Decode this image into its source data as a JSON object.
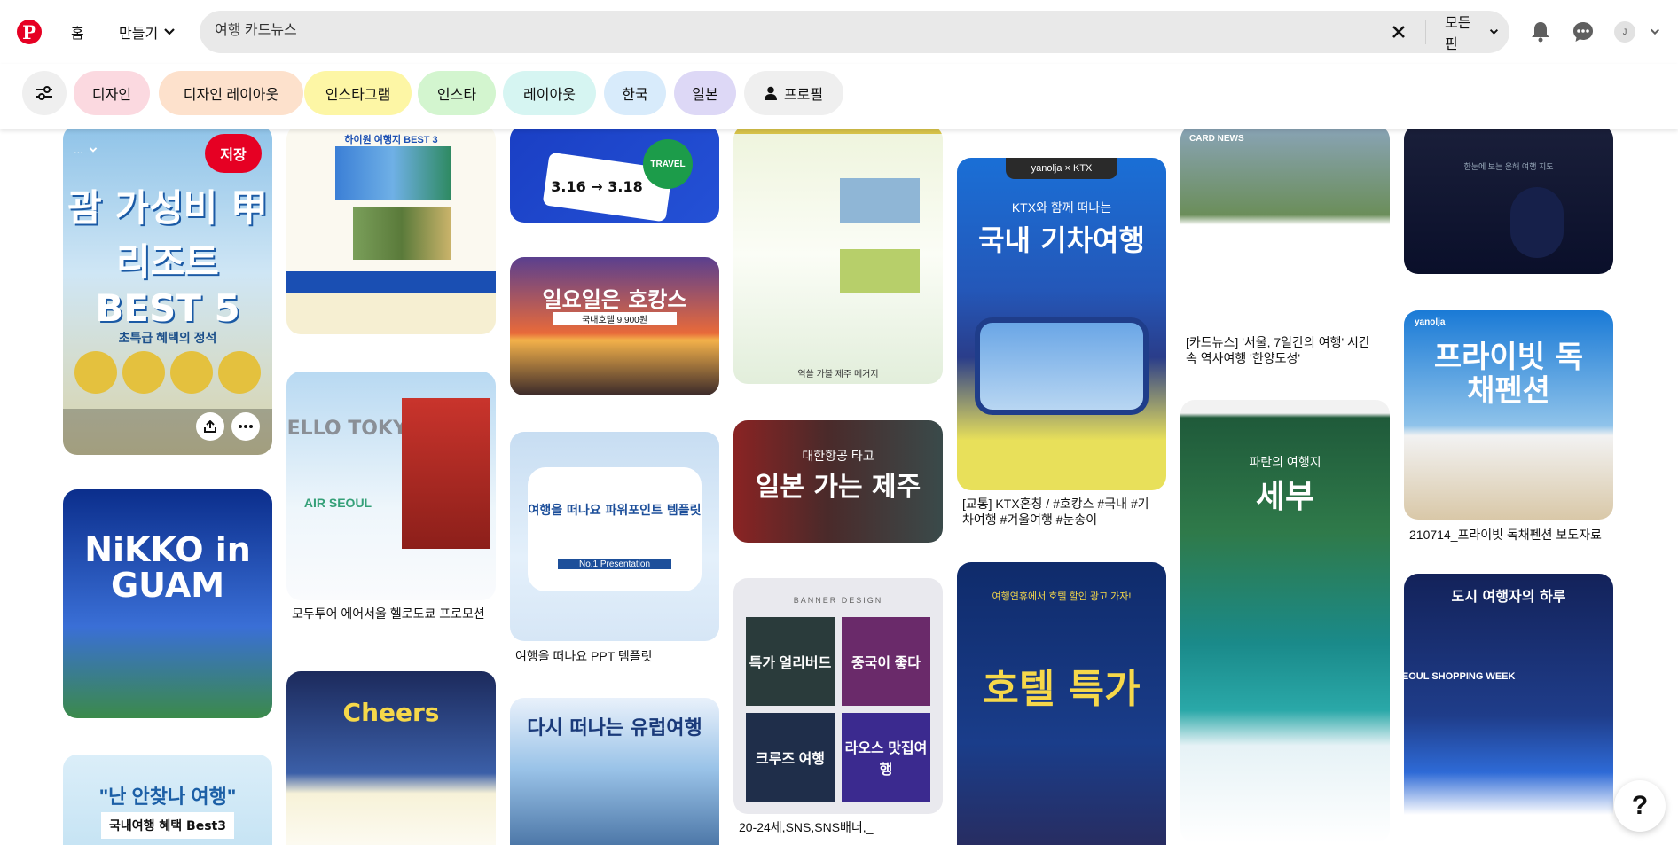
{
  "header": {
    "logo_letter": "P",
    "nav_home": "홈",
    "nav_create": "만들기",
    "search_value": "여행 카드뉴스",
    "filter_dropdown": "모든 핀",
    "avatar_initial": "J"
  },
  "chips": [
    {
      "label": "디자인",
      "color": "#fbd9e0"
    },
    {
      "label": "디자인 레이아웃",
      "color": "#fde1cc"
    },
    {
      "label": "인스타그램",
      "color": "#fdf6a5"
    },
    {
      "label": "인스타",
      "color": "#d3f5cf"
    },
    {
      "label": "레이아웃",
      "color": "#d6f5f2"
    },
    {
      "label": "한국",
      "color": "#d8ebfb"
    },
    {
      "label": "일본",
      "color": "#ddd8f6"
    },
    {
      "label": "프로필",
      "color": "#efefef"
    }
  ],
  "pins": {
    "p1": {
      "text": "괌 가성비 甲 리조트 BEST 5",
      "sub": "초특급 혜택의 정석",
      "dropdown": "...",
      "save": "저장"
    },
    "p2": {
      "text": "NiKKO in GUAM"
    },
    "p3": {
      "text": "국내여행 혜택 Best3",
      "sub": "\"난 안찾나 여행\""
    },
    "p4": {
      "text": "하이원 여행지 BEST 3"
    },
    "p5": {
      "text": "HELLO TOKYO",
      "sub": "AIR SEOUL",
      "title": "모두투어 에어서울 헬로도쿄 프로모션"
    },
    "p6": {
      "text": "Cheers"
    },
    "p7": {
      "text": "3.16 → 3.18",
      "sub": "TRAVEL"
    },
    "p8": {
      "text": "일요일은 호캉스",
      "sub": "국내호텔 9,900원"
    },
    "p9": {
      "text": "여행을 떠나요 파워포인트 템플릿",
      "sub": "No.1 Presentation",
      "title": "여행을 떠나요 PPT 템플릿"
    },
    "p10": {
      "text": "다시 떠나는 유럽여행"
    },
    "p11": {
      "text": "역쓸 가볼 제주 메거지"
    },
    "p12": {
      "text": "일본 가는 제주",
      "sub": "대한항공 타고"
    },
    "p13": {
      "text": "BANNER DESIGN",
      "t1": "특가 얼리버드",
      "t2": "중국이 좋다",
      "t3": "크루즈 여행",
      "t4": "라오스 맛집여행",
      "title": "20-24세,SNS,SNS배너,_"
    },
    "p14": {
      "text": "국내 기차여행",
      "sub": "KTX와 함께 떠나는",
      "brand": "yanolja × KTX",
      "title": "[교통] KTX혼칭 / #호캉스 #국내 #기차여행 #겨울여행 #눈송이"
    },
    "p15": {
      "text": "호텔 특가",
      "sub": "여행연휴에서 호텔 할인 광고 가자!"
    },
    "p16": {
      "text": "CARD NEWS",
      "title": "[카드뉴스] '서울, 7일간의 여행' 시간 속 역사여행 '한양도성'"
    },
    "p17": {
      "text": "세부",
      "sub": "파란의 여행지"
    },
    "p18": {
      "text": "한눈에 보는 운해 여행 지도"
    },
    "p19": {
      "text": "프라이빗 독채펜션",
      "brand": "yanolja",
      "title": "210714_프라이빗 독채펜션 보도자료"
    },
    "p20": {
      "text": "도시 여행자의 하루",
      "sub": "SEOUL SHOPPING WEEK"
    }
  },
  "help_label": "?"
}
